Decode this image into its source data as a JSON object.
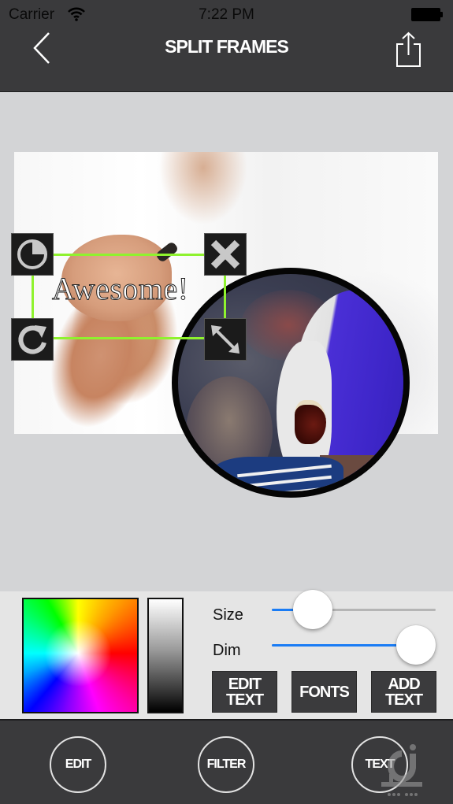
{
  "status_bar": {
    "carrier": "Carrier",
    "time": "7:22 PM",
    "wifi_icon": "wifi-icon",
    "battery_icon": "battery-icon"
  },
  "nav": {
    "title": "SPLIT FRAMES",
    "back_icon": "chevron-left-icon",
    "share_icon": "share-icon"
  },
  "canvas": {
    "text_overlay": "Awesome!",
    "selection_color": "#8ff22e",
    "handles": [
      {
        "position": "top-left",
        "icon": "opacity-pie-icon"
      },
      {
        "position": "top-right",
        "icon": "close-icon"
      },
      {
        "position": "bottom-left",
        "icon": "rotate-icon"
      },
      {
        "position": "bottom-right",
        "icon": "resize-diagonal-icon"
      }
    ]
  },
  "controls": {
    "size_label": "Size",
    "dim_label": "Dim",
    "size_value": 0.25,
    "dim_value": 0.88,
    "slider_color": "#1a7cf5",
    "buttons": {
      "edit_text": "EDIT\nTEXT",
      "fonts": "FONTS",
      "add_text": "ADD\nTEXT"
    }
  },
  "bottom_bar": {
    "edit": "EDIT",
    "filter": "FILTER",
    "text": "TEXT"
  }
}
